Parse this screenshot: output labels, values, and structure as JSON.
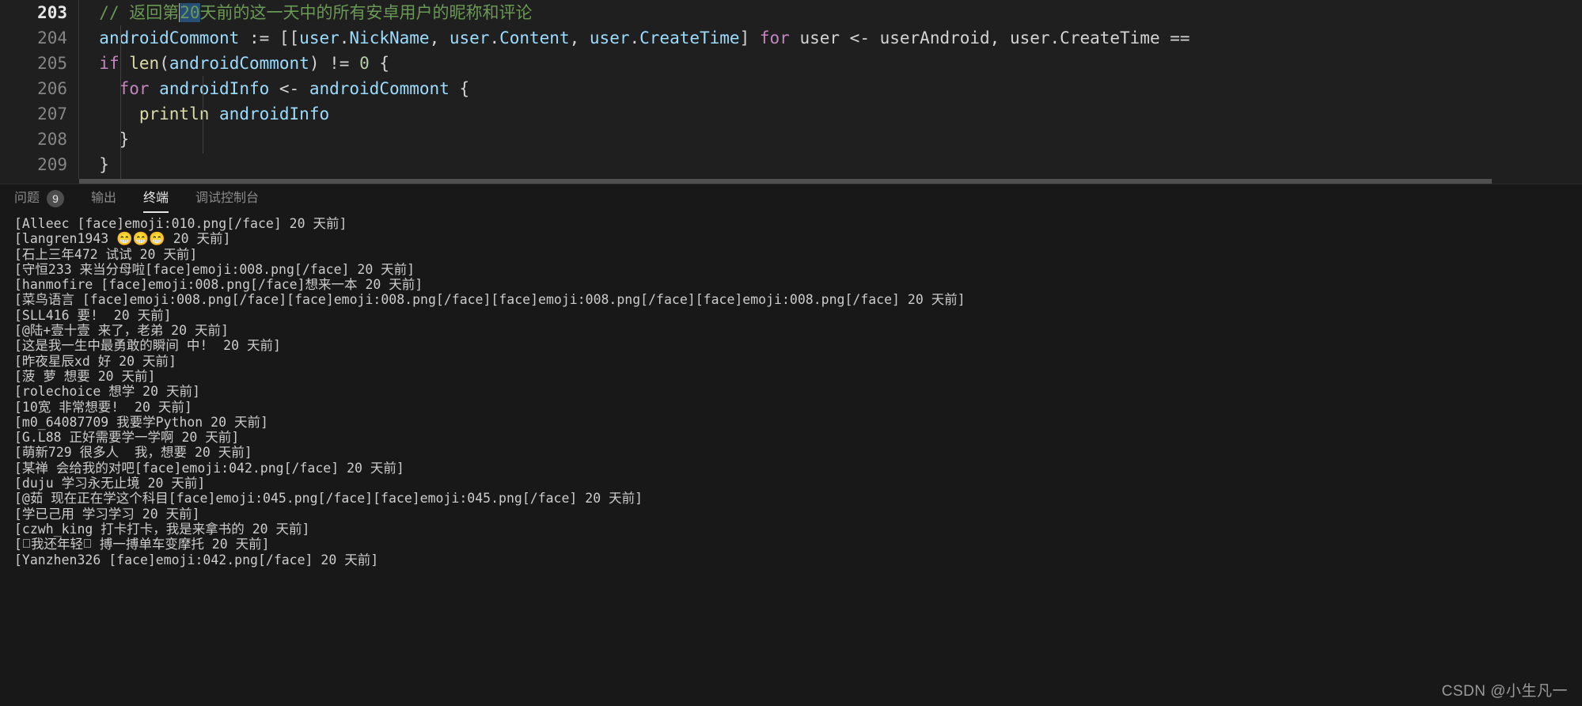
{
  "editor": {
    "lines": [
      {
        "number": "203",
        "active": true,
        "indent": 2,
        "tokens": [
          {
            "cls": "t-comment",
            "text": "// 返回第"
          },
          {
            "cls": "t-comment sel caret-before",
            "text": "20"
          },
          {
            "cls": "t-comment",
            "text": "天前的这一天中的所有安卓用户的昵称和评论"
          }
        ]
      },
      {
        "number": "204",
        "active": false,
        "indent": 2,
        "tokens": [
          {
            "cls": "t-var",
            "text": "androidCommont"
          },
          {
            "cls": "t-plain",
            "text": " := [["
          },
          {
            "cls": "t-var",
            "text": "user"
          },
          {
            "cls": "t-plain",
            "text": "."
          },
          {
            "cls": "t-var",
            "text": "NickName"
          },
          {
            "cls": "t-plain",
            "text": ", "
          },
          {
            "cls": "t-var",
            "text": "user"
          },
          {
            "cls": "t-plain",
            "text": "."
          },
          {
            "cls": "t-var",
            "text": "Content"
          },
          {
            "cls": "t-plain",
            "text": ", "
          },
          {
            "cls": "t-var",
            "text": "user"
          },
          {
            "cls": "t-plain",
            "text": "."
          },
          {
            "cls": "t-var",
            "text": "CreateTime"
          },
          {
            "cls": "t-plain",
            "text": "] "
          },
          {
            "cls": "t-kw",
            "text": "for"
          },
          {
            "cls": "t-plain",
            "text": " user <- userAndroid, user.CreateTime =="
          }
        ]
      },
      {
        "number": "205",
        "active": false,
        "indent": 2,
        "tokens": [
          {
            "cls": "t-kw",
            "text": "if"
          },
          {
            "cls": "t-plain",
            "text": " "
          },
          {
            "cls": "t-fn",
            "text": "len"
          },
          {
            "cls": "t-plain",
            "text": "("
          },
          {
            "cls": "t-var",
            "text": "androidCommont"
          },
          {
            "cls": "t-plain",
            "text": ") != "
          },
          {
            "cls": "t-num",
            "text": "0"
          },
          {
            "cls": "t-plain",
            "text": " {"
          }
        ]
      },
      {
        "number": "206",
        "active": false,
        "indent": 4,
        "tokens": [
          {
            "cls": "t-kw",
            "text": "for"
          },
          {
            "cls": "t-plain",
            "text": " "
          },
          {
            "cls": "t-var",
            "text": "androidInfo"
          },
          {
            "cls": "t-plain",
            "text": " <- "
          },
          {
            "cls": "t-var",
            "text": "androidCommont"
          },
          {
            "cls": "t-plain",
            "text": " {"
          }
        ]
      },
      {
        "number": "207",
        "active": false,
        "indent": 6,
        "tokens": [
          {
            "cls": "t-fn",
            "text": "println"
          },
          {
            "cls": "t-plain",
            "text": " "
          },
          {
            "cls": "t-var",
            "text": "androidInfo"
          }
        ]
      },
      {
        "number": "208",
        "active": false,
        "indent": 4,
        "tokens": [
          {
            "cls": "t-plain",
            "text": "}"
          }
        ]
      },
      {
        "number": "209",
        "active": false,
        "indent": 2,
        "tokens": [
          {
            "cls": "t-plain",
            "text": "}"
          }
        ]
      }
    ]
  },
  "panel": {
    "tabs": [
      {
        "label": "问题",
        "badge": "9",
        "active": false
      },
      {
        "label": "输出",
        "badge": "",
        "active": false
      },
      {
        "label": "终端",
        "badge": "",
        "active": true
      },
      {
        "label": "调试控制台",
        "badge": "",
        "active": false
      }
    ],
    "terminal_lines": [
      "[Alleec [face]emoji:010.png[/face] 20 天前]",
      "[langren1943 😁😁😁 20 天前]",
      "[石上三年472 试试 20 天前]",
      "[守恒233 来当分母啦[face]emoji:008.png[/face] 20 天前]",
      "[hanmofire [face]emoji:008.png[/face]想来一本 20 天前]",
      "[菜鸟语言 [face]emoji:008.png[/face][face]emoji:008.png[/face][face]emoji:008.png[/face][face]emoji:008.png[/face] 20 天前]",
      "[SLL416 要!  20 天前]",
      "[@陆+壹十壹 来了，老弟 20 天前]",
      "[这是我一生中最勇敢的瞬间 中!  20 天前]",
      "[昨夜星辰xd 好 20 天前]",
      "[菠 萝 想要 20 天前]",
      "[rolechoice 想学 20 天前]",
      "[10宽 非常想要!  20 天前]",
      "[m0_64087709 我要学Python 20 天前]",
      "[G.L88 正好需要学一学啊 20 天前]",
      "[萌新729 很多人  我，想要 20 天前]",
      "[某禅 会给我的对吧[face]emoji:042.png[/face] 20 天前]",
      "[duju 学习永无止境 20 天前]",
      "[@茹 现在正在学这个科目[face]emoji:045.png[/face][face]emoji:045.png[/face] 20 天前]",
      "[学已己用 学习学习 20 天前]",
      "[czwh_king 打卡打卡，我是来拿书的 20 天前]",
      "[□我还年轻□ 搏一搏单车变摩托 20 天前]",
      "[Yanzhen326 [face]emoji:042.png[/face] 20 天前]"
    ]
  },
  "watermark": {
    "text": "CSDN @小生凡一"
  },
  "colors": {
    "editor_bg": "#1f1f1f",
    "panel_bg": "#181818",
    "comment": "#6a9955",
    "keyword": "#c586c0",
    "function": "#dcdcaa",
    "variable": "#9cdcfe",
    "selection": "#264f78",
    "terminal_fg": "#cccccc",
    "tab_active_fg": "#e7e7e7",
    "tab_inactive_fg": "#8b8b8b"
  }
}
